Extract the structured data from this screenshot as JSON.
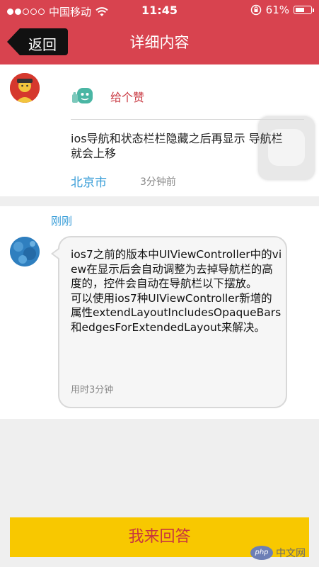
{
  "status_bar": {
    "carrier": "中国移动",
    "time": "11:45",
    "battery": "61%",
    "battery_level": 0.61
  },
  "nav": {
    "back_label": "返回",
    "title": "详细内容"
  },
  "question": {
    "like_label": "给个赞",
    "text": "ios导航和状态栏栏隐藏之后再显示 导航栏就会上移",
    "city": "北京市",
    "time": "3分钟前"
  },
  "answer": {
    "time": "刚刚",
    "text": "ios7之前的版本中UIViewController中的view在显示后会自动调整为去掉导航栏的高度的，控件会自动在导航栏以下摆放。\n可以使用ios7种UIViewController新增的属性extendLayoutIncludesOpaqueBars和edgesForExtendedLayout来解决。",
    "duration": "用时3分钟"
  },
  "footer": {
    "answer_button": "我来回答"
  },
  "watermark": {
    "logo": "php",
    "site": "中文网"
  },
  "colors": {
    "header": "#d8434f",
    "accent_blue": "#3a9ed8",
    "button_yellow": "#f8c800",
    "button_text": "#c8363f"
  }
}
